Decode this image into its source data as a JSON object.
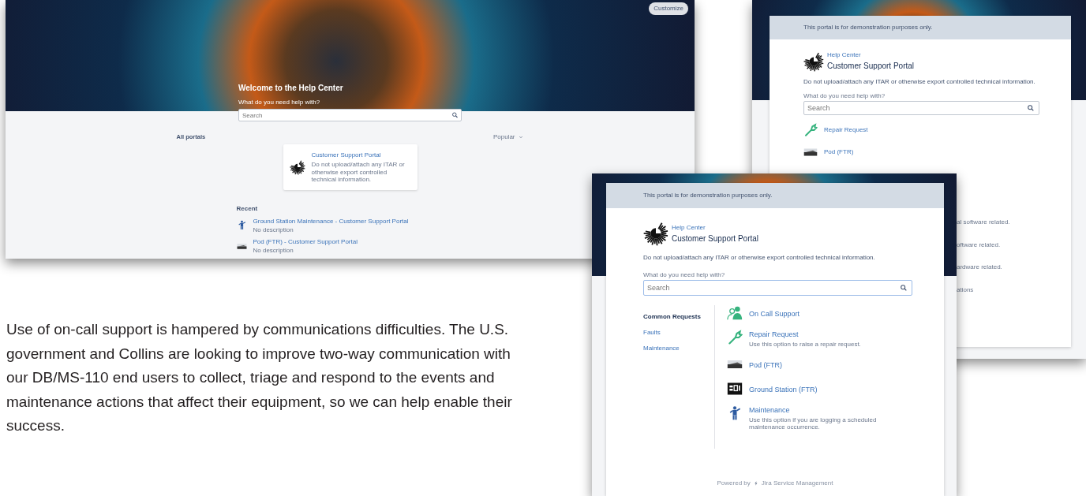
{
  "help_center_screenshot": {
    "customize_button": "Customize",
    "welcome_title": "Welcome to the Help Center",
    "search_label": "What do you need help with?",
    "search_placeholder": "Search",
    "all_portals_title": "All portals",
    "sort_dropdown": "Popular",
    "portal_card": {
      "title": "Customer Support Portal",
      "description": "Do not upload/attach any ITAR or otherwise export controlled technical information."
    },
    "recent_title": "Recent",
    "recent_items": [
      {
        "kind": "maintenance",
        "title": "Ground Station Maintenance - Customer Support Portal",
        "description": "No description"
      },
      {
        "kind": "pod",
        "title": "Pod (FTR) - Customer Support Portal",
        "description": "No description"
      }
    ]
  },
  "portal_screenshot_back": {
    "notice": "This portal is for demonstration purposes only.",
    "breadcrumb": "Help Center",
    "portal_title": "Customer Support Portal",
    "warning": "Do not upload/attach any ITAR or otherwise export controlled technical information.",
    "search_label": "What do you need help with?",
    "search_placeholder": "Search",
    "request_types": [
      {
        "kind": "wrench",
        "title": "Repair Request"
      },
      {
        "kind": "pod",
        "title": "Pod (FTR)"
      }
    ],
    "partly_hidden_descriptions": [
      "al software related.",
      "oftware related.",
      "ardware related.",
      "ations"
    ]
  },
  "portal_screenshot_front": {
    "notice": "This portal is for demonstration purposes only.",
    "breadcrumb": "Help Center",
    "portal_title": "Customer Support Portal",
    "warning": "Do not upload/attach any ITAR or otherwise export controlled technical information.",
    "search_label": "What do you need help with?",
    "search_placeholder": "Search",
    "groups": [
      {
        "label": "Common Requests",
        "selected": true
      },
      {
        "label": "Faults",
        "selected": false
      },
      {
        "label": "Maintenance",
        "selected": false
      }
    ],
    "request_types": [
      {
        "kind": "people",
        "title": "On Call Support"
      },
      {
        "kind": "wrench",
        "title": "Repair Request",
        "description": "Use this option to raise a repair request."
      },
      {
        "kind": "pod",
        "title": "Pod (FTR)"
      },
      {
        "kind": "sci",
        "title": "Ground Station (FTR)"
      },
      {
        "kind": "maintenance",
        "title": "Maintenance",
        "description": "Use this option if you are logging a scheduled maintenance occurrence."
      }
    ],
    "footer_prefix": "Powered by",
    "footer_product": "Jira Service Management"
  },
  "body_text": "Use of on-call support is hampered by communications difficulties. The U.S. government and Collins are looking to improve two-way communication with our DB/MS-110 end users to collect, triage and respond to the events and maintenance actions that affect their equipment, so we can help enable their success."
}
